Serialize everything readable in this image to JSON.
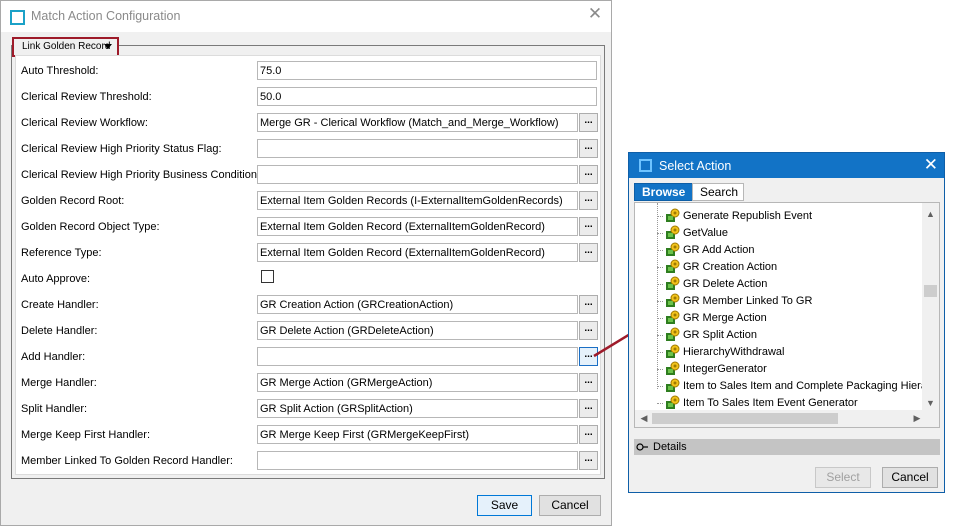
{
  "main_dialog": {
    "title": "Match Action Configuration",
    "group_dropdown": "Link Golden Record",
    "fields": [
      {
        "label": "Auto Threshold:",
        "value": "75.0",
        "type": "text"
      },
      {
        "label": "Clerical Review Threshold:",
        "value": "50.0",
        "type": "text"
      },
      {
        "label": "Clerical Review Workflow:",
        "value": "Merge GR - Clerical Workflow (Match_and_Merge_Workflow)",
        "type": "browse"
      },
      {
        "label": "Clerical Review High Priority Status Flag:",
        "value": "",
        "type": "browse"
      },
      {
        "label": "Clerical Review High Priority Business Condition:",
        "value": "",
        "type": "browse"
      },
      {
        "label": "Golden Record Root:",
        "value": "External Item Golden Records (I-ExternalItemGoldenRecords)",
        "type": "browse"
      },
      {
        "label": "Golden Record Object Type:",
        "value": "External Item Golden Record (ExternalItemGoldenRecord)",
        "type": "browse"
      },
      {
        "label": "Reference Type:",
        "value": "External Item Golden Record (ExternalItemGoldenRecord)",
        "type": "browse"
      },
      {
        "label": "Auto Approve:",
        "value": "",
        "type": "checkbox"
      },
      {
        "label": "Create Handler:",
        "value": "GR Creation Action (GRCreationAction)",
        "type": "browse"
      },
      {
        "label": "Delete Handler:",
        "value": "GR Delete Action (GRDeleteAction)",
        "type": "browse"
      },
      {
        "label": "Add Handler:",
        "value": "",
        "type": "browse"
      },
      {
        "label": "Merge Handler:",
        "value": "GR Merge Action (GRMergeAction)",
        "type": "browse"
      },
      {
        "label": "Split Handler:",
        "value": "GR Split Action (GRSplitAction)",
        "type": "browse"
      },
      {
        "label": "Merge Keep First Handler:",
        "value": "GR Merge Keep First (GRMergeKeepFirst)",
        "type": "browse"
      },
      {
        "label": "Member Linked To Golden Record Handler:",
        "value": "",
        "type": "browse"
      }
    ],
    "browse_label": "...",
    "save_label": "Save",
    "cancel_label": "Cancel"
  },
  "select_dialog": {
    "title": "Select Action",
    "tabs": [
      "Browse",
      "Search"
    ],
    "items": [
      "Generate Republish Event",
      "GetValue",
      "GR Add Action",
      "GR Creation Action",
      "GR Delete Action",
      "GR Member Linked To GR",
      "GR Merge Action",
      "GR Split Action",
      "HierarchyWithdrawal",
      "IntegerGenerator",
      "Item to Sales Item and Complete Packaging Hierarc",
      "Item To Sales Item Event Generator"
    ],
    "details_label": "Details",
    "select_label": "Select",
    "cancel_label": "Cancel"
  },
  "colors": {
    "accent": "#1273c6",
    "highlight_border": "#9e1b2a",
    "arrow": "#9e1b2a"
  }
}
